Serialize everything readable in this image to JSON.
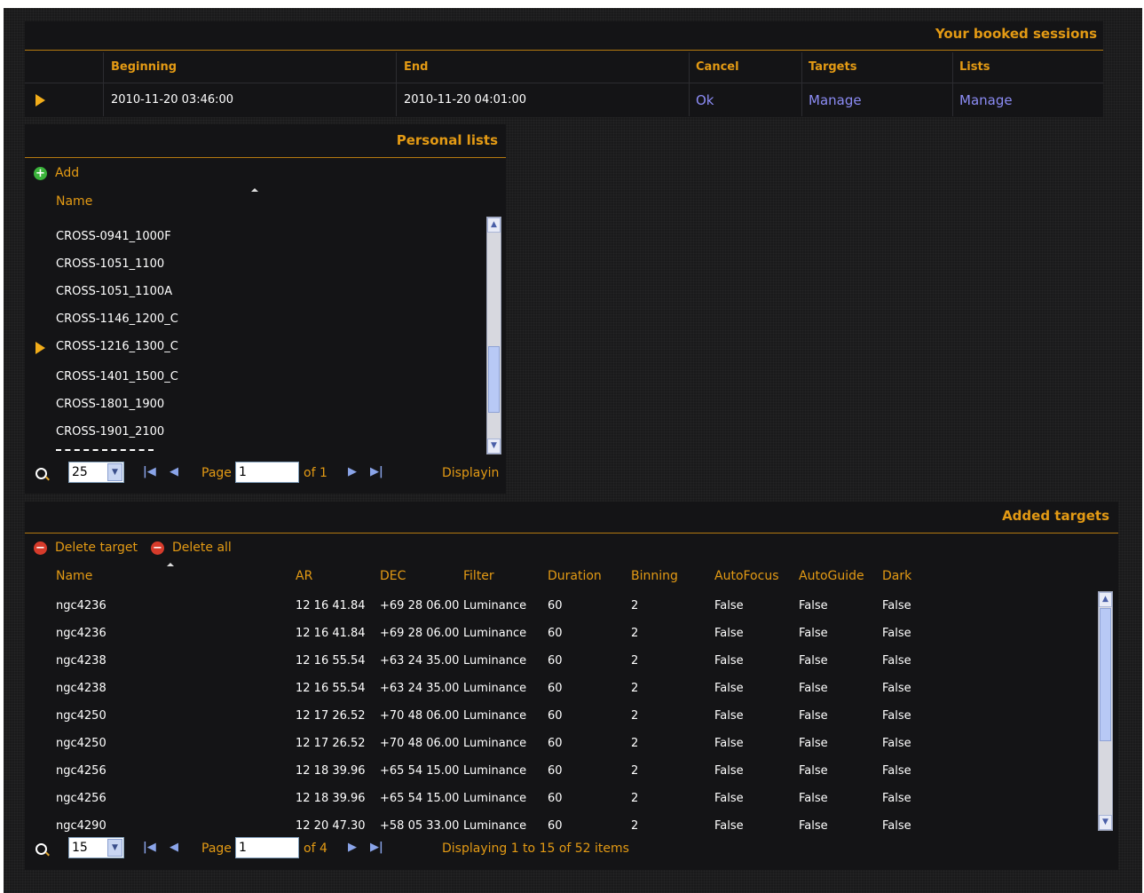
{
  "booked_sessions": {
    "title": "Your booked sessions",
    "columns": [
      "Beginning",
      "End",
      "Cancel",
      "Targets",
      "Lists"
    ],
    "row": {
      "beginning": "2010-11-20 03:46:00",
      "end": "2010-11-20 04:01:00",
      "cancel": "Ok",
      "targets": "Manage",
      "lists": "Manage"
    }
  },
  "personal_lists": {
    "title": "Personal lists",
    "add_label": "Add",
    "column_name": "Name",
    "items": [
      "CROSS-0941_1000F",
      "CROSS-1051_1100",
      "CROSS-1051_1100A",
      "CROSS-1146_1200_C",
      "CROSS-1216_1300_C",
      "CROSS-1401_1500_C",
      "CROSS-1801_1900",
      "CROSS-1901_2100"
    ],
    "selected_index": 4,
    "pager": {
      "page_size": "25",
      "page_label": "Page",
      "page_value": "1",
      "of_label": "of 1",
      "displaying": "Displayin"
    }
  },
  "added_targets": {
    "title": "Added targets",
    "delete_target_label": "Delete target",
    "delete_all_label": "Delete all",
    "columns": [
      "Name",
      "AR",
      "DEC",
      "Filter",
      "Duration",
      "Binning",
      "AutoFocus",
      "AutoGuide",
      "Dark"
    ],
    "rows": [
      [
        "ngc4236",
        "12 16 41.84",
        "+69 28 06.00",
        "Luminance",
        "60",
        "2",
        "False",
        "False",
        "False"
      ],
      [
        "ngc4236",
        "12 16 41.84",
        "+69 28 06.00",
        "Luminance",
        "60",
        "2",
        "False",
        "False",
        "False"
      ],
      [
        "ngc4238",
        "12 16 55.54",
        "+63 24 35.00",
        "Luminance",
        "60",
        "2",
        "False",
        "False",
        "False"
      ],
      [
        "ngc4238",
        "12 16 55.54",
        "+63 24 35.00",
        "Luminance",
        "60",
        "2",
        "False",
        "False",
        "False"
      ],
      [
        "ngc4250",
        "12 17 26.52",
        "+70 48 06.00",
        "Luminance",
        "60",
        "2",
        "False",
        "False",
        "False"
      ],
      [
        "ngc4250",
        "12 17 26.52",
        "+70 48 06.00",
        "Luminance",
        "60",
        "2",
        "False",
        "False",
        "False"
      ],
      [
        "ngc4256",
        "12 18 39.96",
        "+65 54 15.00",
        "Luminance",
        "60",
        "2",
        "False",
        "False",
        "False"
      ],
      [
        "ngc4256",
        "12 18 39.96",
        "+65 54 15.00",
        "Luminance",
        "60",
        "2",
        "False",
        "False",
        "False"
      ],
      [
        "ngc4290",
        "12 20 47.30",
        "+58 05 33.00",
        "Luminance",
        "60",
        "2",
        "False",
        "False",
        "False"
      ]
    ],
    "pager": {
      "page_size": "15",
      "page_label": "Page",
      "page_value": "1",
      "of_label": "of 4",
      "displaying": "Displaying 1 to 15 of 52 items"
    }
  },
  "colors": {
    "accent": "#e39a14",
    "link": "#8c8cf5",
    "background": "#1a1a1b"
  }
}
